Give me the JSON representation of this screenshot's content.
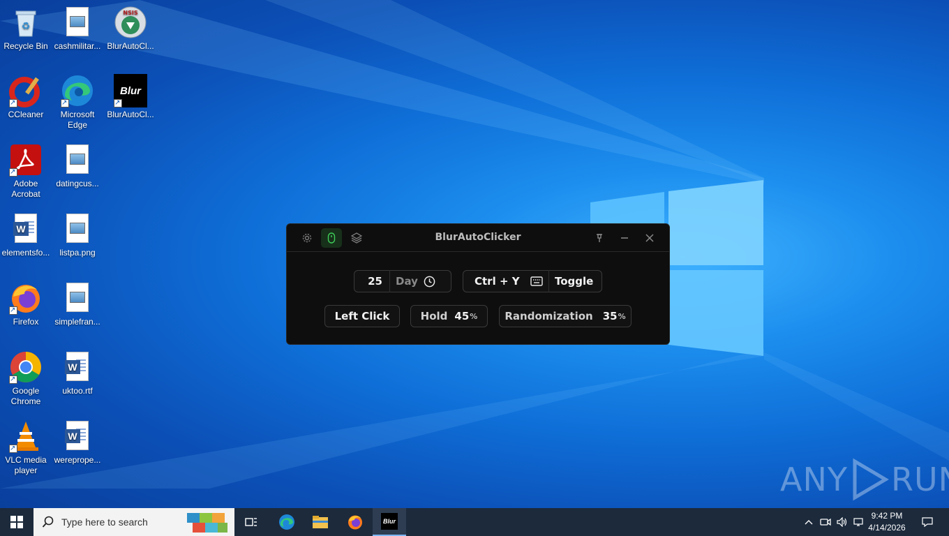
{
  "desktop": {
    "icons": [
      {
        "label": "Recycle Bin"
      },
      {
        "label": "cashmilitar..."
      },
      {
        "label": "BlurAutoCl..."
      },
      {
        "label": "CCleaner"
      },
      {
        "label": "Microsoft Edge"
      },
      {
        "label": "BlurAutoCl..."
      },
      {
        "label": "Adobe Acrobat"
      },
      {
        "label": "datingcus..."
      },
      {
        "label": "elementsfo..."
      },
      {
        "label": "listpa.png"
      },
      {
        "label": "Firefox"
      },
      {
        "label": "simplefran..."
      },
      {
        "label": "Google Chrome"
      },
      {
        "label": "uktoo.rtf"
      },
      {
        "label": "VLC media player"
      },
      {
        "label": "wereprope..."
      }
    ],
    "blur_logo_text": "Blur",
    "nsis_text": "NSIS"
  },
  "app": {
    "title": "BlurAutoClicker",
    "interval_value": "25",
    "interval_unit": "Day",
    "hotkey": "Ctrl + Y",
    "hotkey_mode": "Toggle",
    "click_type": "Left Click",
    "hold_label": "Hold",
    "hold_value": "45",
    "random_label": "Randomization",
    "random_value": "35",
    "percent": "%"
  },
  "taskbar": {
    "search_placeholder": "Type here to search",
    "time": "9:42 PM",
    "date": "4/14/2026",
    "active_app_label": "Blur"
  },
  "watermark": {
    "left": "ANY",
    "right": "RUN"
  },
  "colors": {
    "accent_green": "#3fd15a",
    "taskbar": "#1c2a3c",
    "window_bg": "#0e0e0e"
  }
}
